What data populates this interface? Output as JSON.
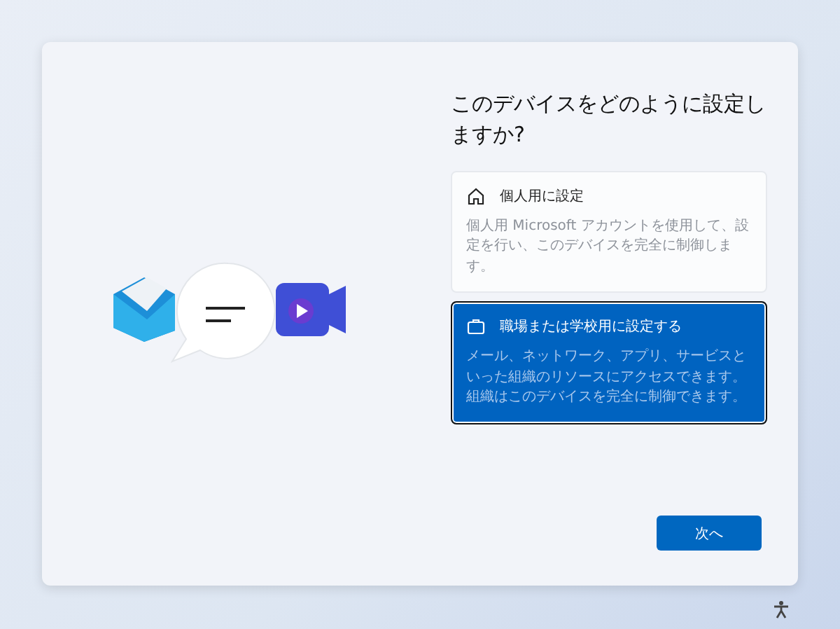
{
  "title": "このデバイスをどのように設定しますか?",
  "options": [
    {
      "label": "個人用に設定",
      "description": "個人用 Microsoft アカウントを使用して、設定を行い、このデバイスを完全に制御します。",
      "selected": false
    },
    {
      "label": "職場または学校用に設定する",
      "description": "メール、ネットワーク、アプリ、サービスといった組織のリソースにアクセスできます。組織はこのデバイスを完全に制御できます。",
      "selected": true
    }
  ],
  "next_button": "次へ"
}
